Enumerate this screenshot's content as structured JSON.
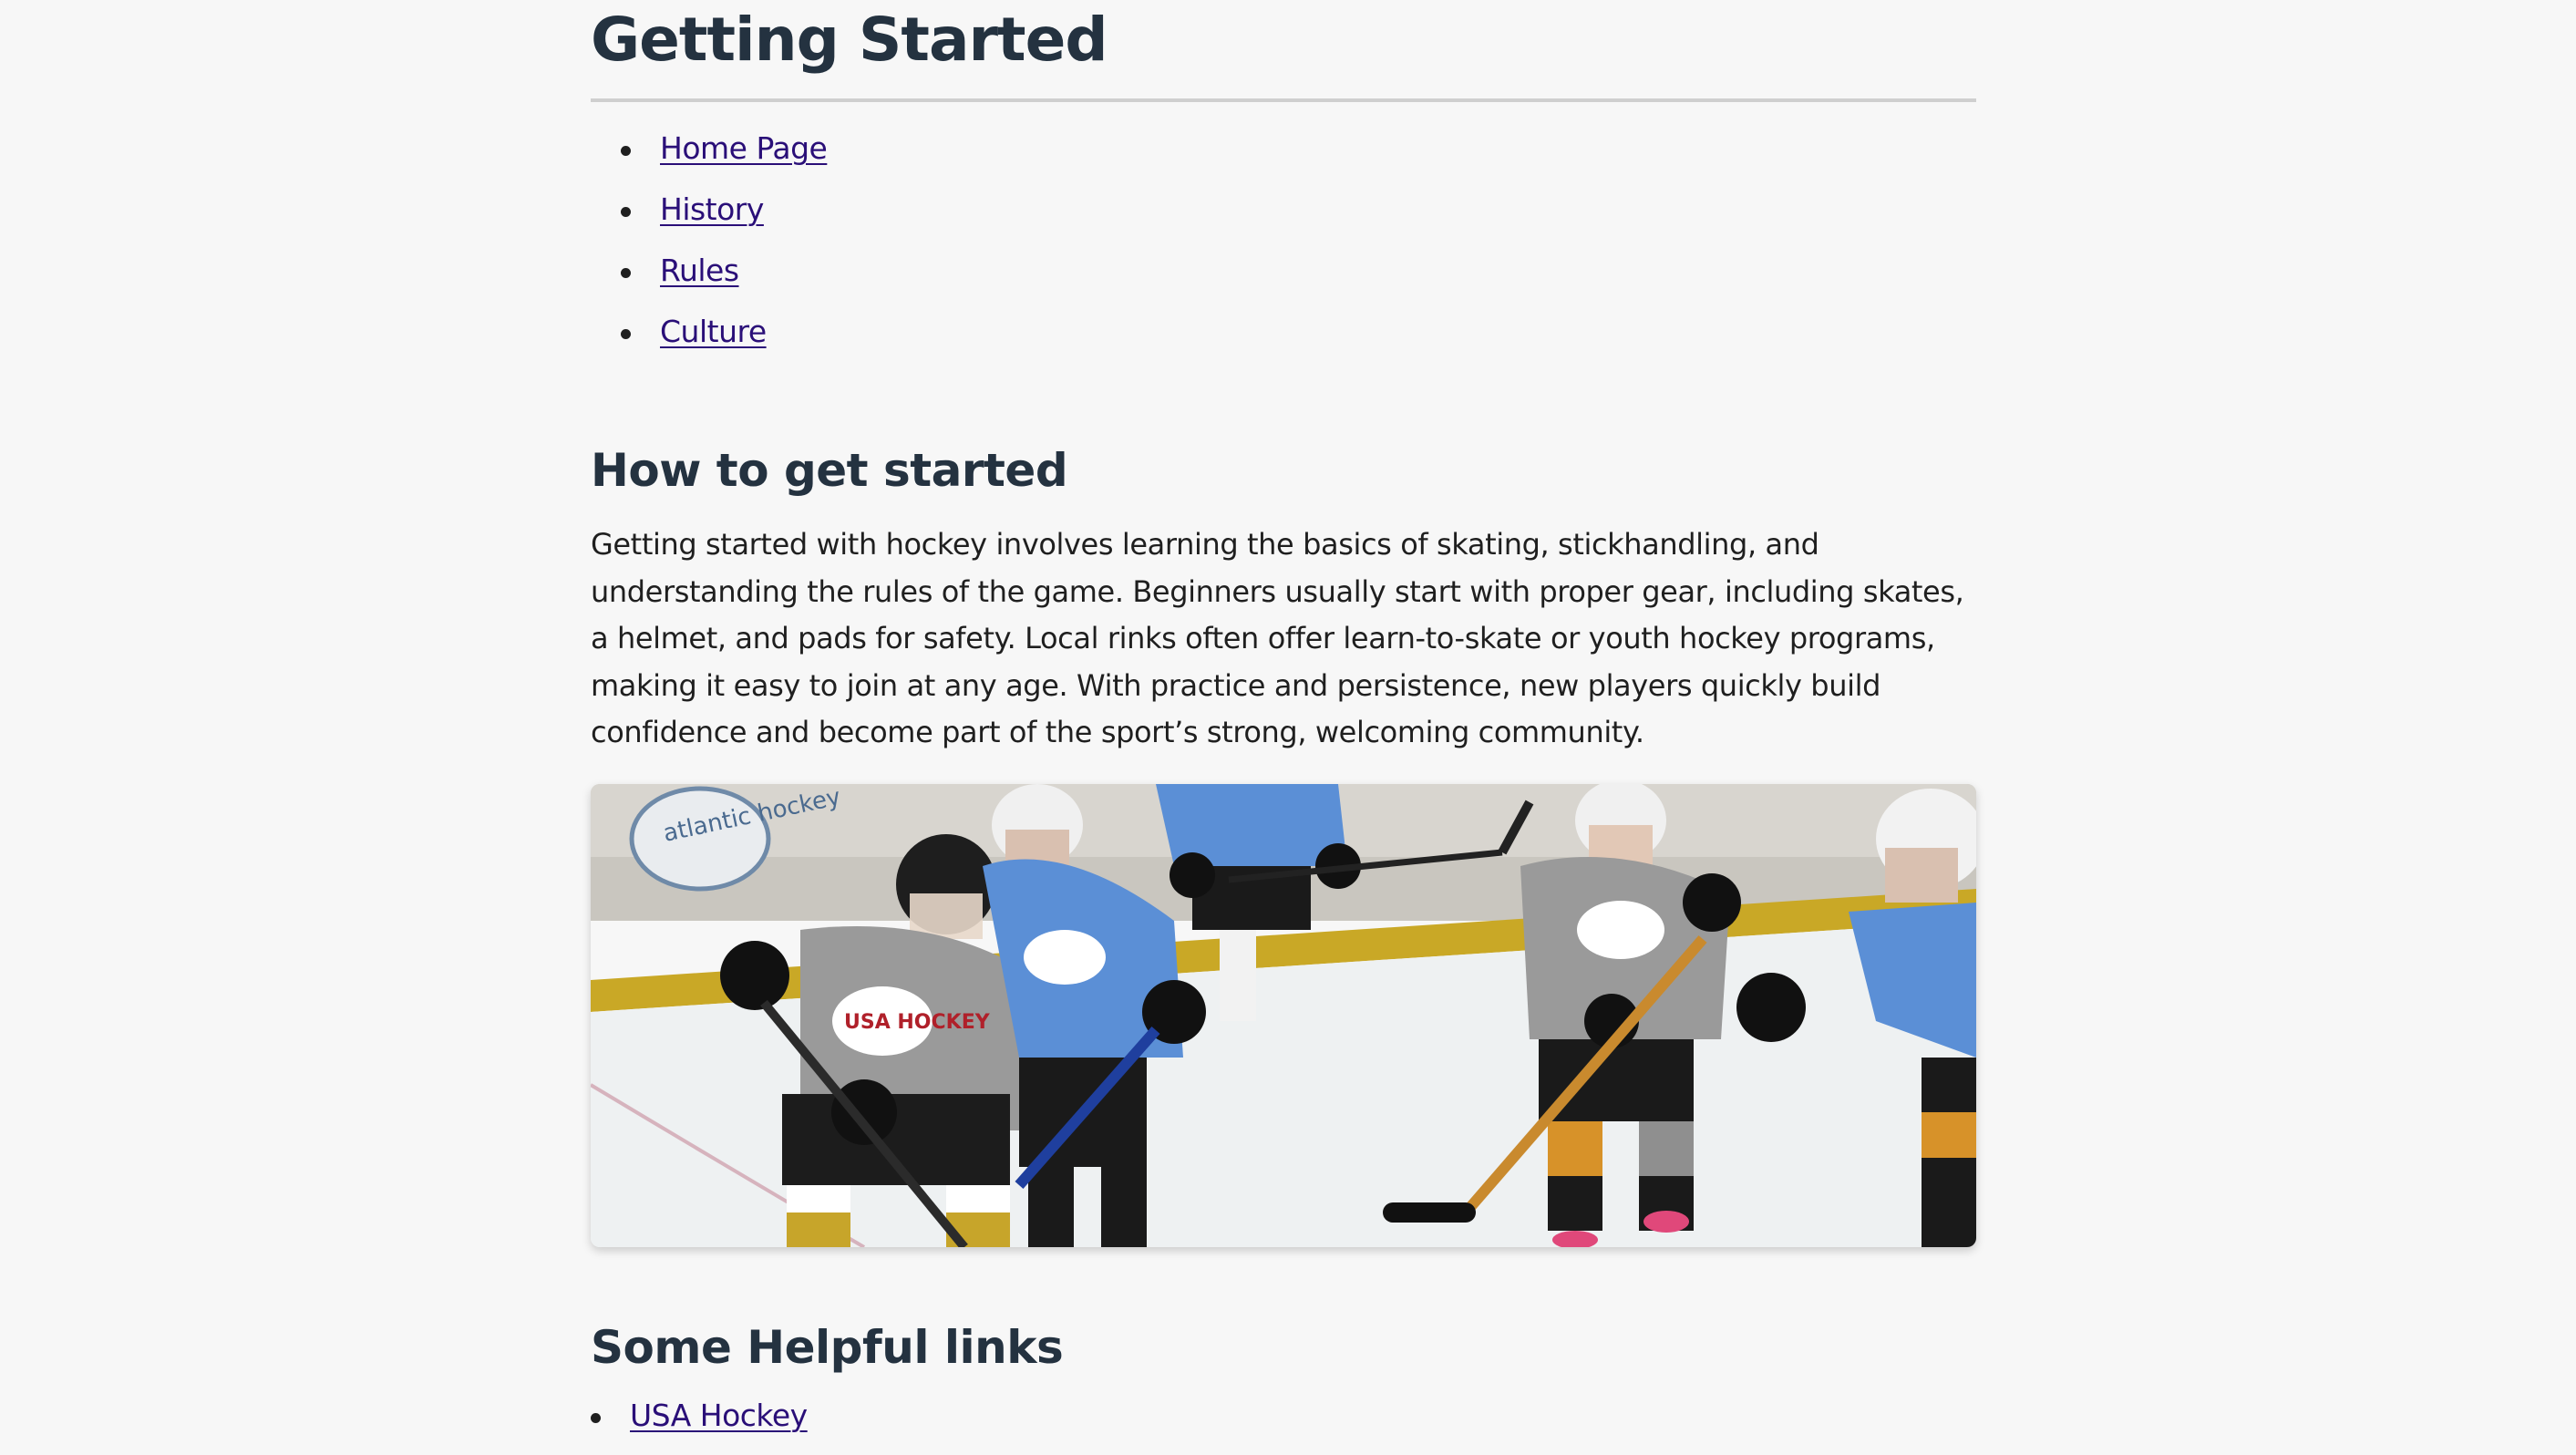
{
  "page": {
    "title": "Getting Started"
  },
  "nav": {
    "items": [
      {
        "label": "Home Page"
      },
      {
        "label": "History"
      },
      {
        "label": "Rules"
      },
      {
        "label": "Culture"
      }
    ]
  },
  "section_started": {
    "heading": "How to get started",
    "paragraph": "Getting started with hockey involves learning the basics of skating, stickhandling, and understanding the rules of the game. Beginners usually start with proper gear, including skates, a helmet, and pads for safety. Local rinks often offer learn-to-skate or youth hockey programs, making it easy to join at any age. With practice and persistence, new players quickly build confidence and become part of the sport’s strong, welcoming community.",
    "image": {
      "rink_sign_text": "atlantic hockey",
      "jersey_text": "USA HOCKEY"
    }
  },
  "section_links": {
    "heading": "Some Helpful links",
    "items": [
      {
        "label": "USA Hockey"
      }
    ]
  },
  "colors": {
    "background": "#f7f7f7",
    "heading": "#243240",
    "link": "#2a0f78",
    "text": "#1f1f1f",
    "rule": "#cfcfcf"
  }
}
